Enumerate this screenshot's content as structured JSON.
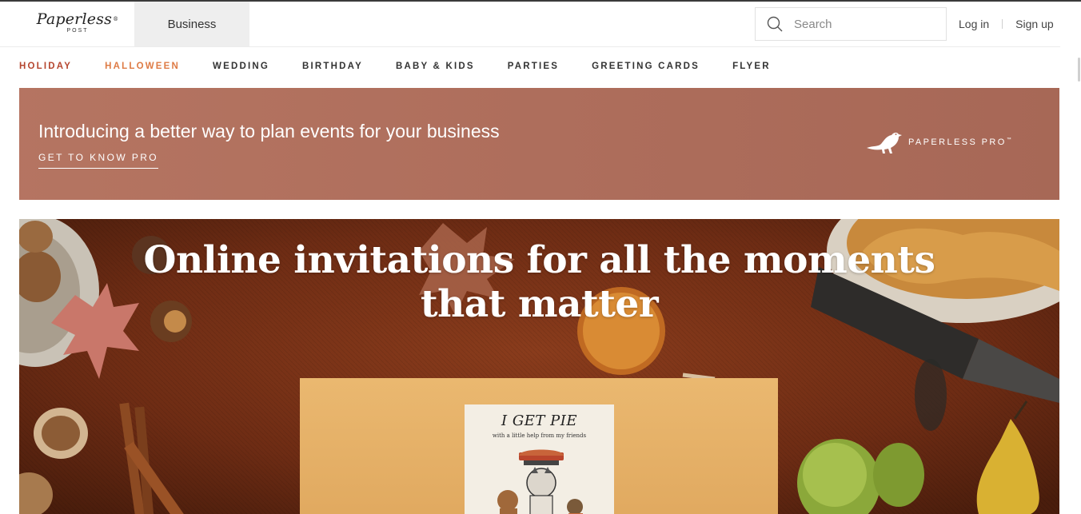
{
  "header": {
    "logo": {
      "script": "Paperless",
      "reg": "®",
      "sub": "POST"
    },
    "business_tab": "Business",
    "search": {
      "placeholder": "Search",
      "value": ""
    },
    "login": "Log in",
    "signup": "Sign up"
  },
  "nav": {
    "items": [
      {
        "label": "HOLIDAY",
        "color": "#b5462f"
      },
      {
        "label": "HALLOWEEN",
        "color": "#de7b45"
      },
      {
        "label": "WEDDING"
      },
      {
        "label": "BIRTHDAY"
      },
      {
        "label": "BABY & KIDS"
      },
      {
        "label": "PARTIES"
      },
      {
        "label": "GREETING CARDS"
      },
      {
        "label": "FLYER"
      }
    ]
  },
  "promo": {
    "title": "Introducing a better way to plan events for your business",
    "link": "GET TO KNOW PRO",
    "brand": "PAPERLESS PRO",
    "tm": "™",
    "background": "#b0705e"
  },
  "hero": {
    "title_line1": "Online invitations for all the moments",
    "title_line2": "that matter",
    "card_title": "I GET PIE",
    "card_subtitle": "with a little help from my friends",
    "envelope_color": "#e3ac63"
  },
  "icons": {
    "search": "search-icon",
    "bird": "bird-icon"
  }
}
